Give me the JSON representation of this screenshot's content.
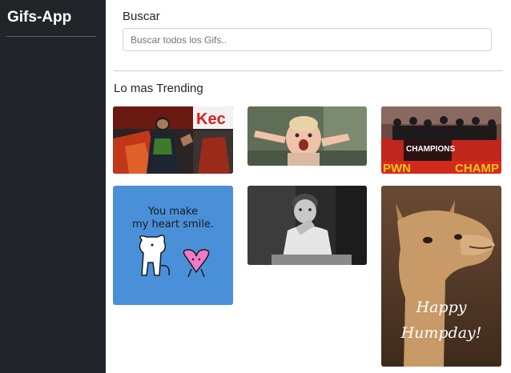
{
  "app": {
    "title": "Gifs-App"
  },
  "search": {
    "label": "Buscar",
    "placeholder": "Buscar todos los Gifs.."
  },
  "trending": {
    "title": "Lo mas Trending",
    "gifs": [
      {
        "name": "gif-racer-motorcycle",
        "text": ""
      },
      {
        "name": "gif-baby-reaction",
        "text": ""
      },
      {
        "name": "gif-champions-bus",
        "text": "CHAMPIONS"
      },
      {
        "name": "gif-heart-smile",
        "text": "You make my heart smile."
      },
      {
        "name": "gif-kid-thinking",
        "text": ""
      },
      {
        "name": "gif-happy-humpday",
        "text": "Happy Humpday!"
      }
    ]
  },
  "colors": {
    "sidebar": "#212529",
    "card_blue": "#4a90d9"
  }
}
